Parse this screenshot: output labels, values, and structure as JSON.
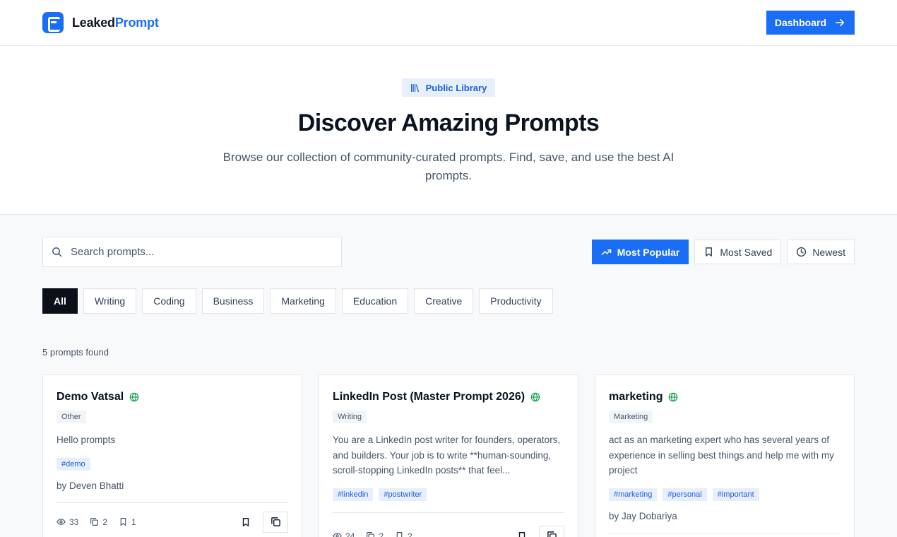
{
  "brand": {
    "name_part1": "Leaked",
    "name_part2": "Prompt",
    "accent": "#1a6ef5"
  },
  "header": {
    "dashboard_label": "Dashboard"
  },
  "hero": {
    "pill_label": "Public Library",
    "title": "Discover Amazing Prompts",
    "subtitle": "Browse our collection of community-curated prompts. Find, save, and use the best AI prompts."
  },
  "search": {
    "placeholder": "Search prompts...",
    "value": ""
  },
  "sort": {
    "options": [
      {
        "label": "Most Popular",
        "icon": "trending-up-icon",
        "active": true
      },
      {
        "label": "Most Saved",
        "icon": "bookmark-icon",
        "active": false
      },
      {
        "label": "Newest",
        "icon": "clock-icon",
        "active": false
      }
    ]
  },
  "categories": [
    "All",
    "Writing",
    "Coding",
    "Business",
    "Marketing",
    "Education",
    "Creative",
    "Productivity"
  ],
  "active_category": "All",
  "results": {
    "count_text": "5 prompts found"
  },
  "cards": [
    {
      "title": "Demo Vatsal",
      "category": "Other",
      "description": "Hello prompts",
      "tags": [
        "#demo"
      ],
      "author": "by Deven Bhatti",
      "views": "33",
      "copies": "2",
      "saves": "1"
    },
    {
      "title": "LinkedIn Post (Master Prompt 2026)",
      "category": "Writing",
      "description": "You are a LinkedIn post writer for founders, operators, and builders. Your job is to write **human-sounding, scroll-stopping LinkedIn posts** that feel...",
      "tags": [
        "#linkedin",
        "#postwriter"
      ],
      "author": "",
      "views": "24",
      "copies": "2",
      "saves": "2"
    },
    {
      "title": "marketing",
      "category": "Marketing",
      "description": "act as an marketing expert who has several years of experience in selling best things and help me with my project",
      "tags": [
        "#marketing",
        "#personal",
        "#important"
      ],
      "author": "by Jay Dobariya",
      "views": "",
      "copies": "",
      "saves": ""
    }
  ]
}
